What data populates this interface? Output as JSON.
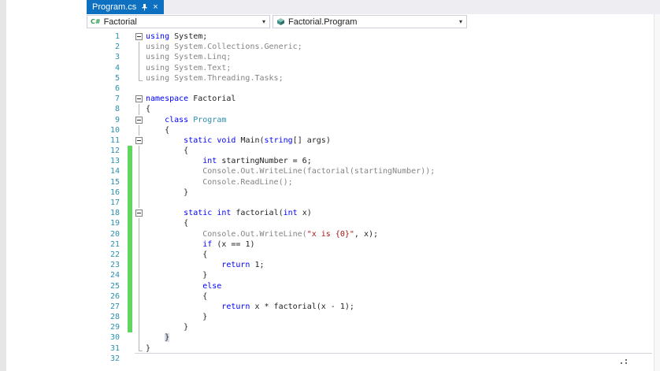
{
  "tab": {
    "title": "Program.cs",
    "close_label": "×"
  },
  "navbar": {
    "dropdown_arrow": "▾",
    "type_selector": {
      "value": "Factorial",
      "icon_label": "C#"
    },
    "member_selector": {
      "value": "Factorial.Program"
    }
  },
  "colors": {
    "tab_active": "#0e70c0",
    "keyword": "#0000ff",
    "type": "#2b91af",
    "string": "#a31515",
    "dimmed": "#848484",
    "default_text": "#1f1f1f",
    "line_number": "#2b91af",
    "change_bar": "#5fd75f"
  },
  "editor": {
    "lines": [
      {
        "n": 1,
        "fold": "minus",
        "chg": false,
        "tokens": [
          {
            "t": "using",
            "c": "k"
          },
          {
            "t": " System;",
            "c": "d"
          }
        ]
      },
      {
        "n": 2,
        "fold": "line",
        "chg": false,
        "tokens": [
          {
            "t": "using System.Collections.Generic;",
            "c": "g"
          }
        ]
      },
      {
        "n": 3,
        "fold": "line",
        "chg": false,
        "tokens": [
          {
            "t": "using System.Linq;",
            "c": "g"
          }
        ]
      },
      {
        "n": 4,
        "fold": "line",
        "chg": false,
        "tokens": [
          {
            "t": "using System.Text;",
            "c": "g"
          }
        ]
      },
      {
        "n": 5,
        "fold": "end",
        "chg": false,
        "tokens": [
          {
            "t": "using System.Threading.Tasks;",
            "c": "g"
          }
        ]
      },
      {
        "n": 6,
        "fold": "",
        "chg": false,
        "tokens": []
      },
      {
        "n": 7,
        "fold": "minus",
        "chg": false,
        "tokens": [
          {
            "t": "namespace",
            "c": "k"
          },
          {
            "t": " Factorial",
            "c": "d"
          }
        ]
      },
      {
        "n": 8,
        "fold": "line",
        "chg": false,
        "tokens": [
          {
            "t": "{",
            "c": "d"
          }
        ]
      },
      {
        "n": 9,
        "fold": "minus",
        "chg": false,
        "tokens": [
          {
            "t": "    ",
            "c": "d"
          },
          {
            "t": "class",
            "c": "k"
          },
          {
            "t": " ",
            "c": "d"
          },
          {
            "t": "Program",
            "c": "t"
          }
        ]
      },
      {
        "n": 10,
        "fold": "line",
        "chg": false,
        "tokens": [
          {
            "t": "    {",
            "c": "d"
          }
        ]
      },
      {
        "n": 11,
        "fold": "minus",
        "chg": false,
        "tokens": [
          {
            "t": "        ",
            "c": "d"
          },
          {
            "t": "static",
            "c": "k"
          },
          {
            "t": " ",
            "c": "d"
          },
          {
            "t": "void",
            "c": "k"
          },
          {
            "t": " Main(",
            "c": "d"
          },
          {
            "t": "string",
            "c": "k"
          },
          {
            "t": "[] args)",
            "c": "d"
          }
        ]
      },
      {
        "n": 12,
        "fold": "line",
        "chg": true,
        "tokens": [
          {
            "t": "        {",
            "c": "d"
          }
        ]
      },
      {
        "n": 13,
        "fold": "line",
        "chg": true,
        "tokens": [
          {
            "t": "            ",
            "c": "d"
          },
          {
            "t": "int",
            "c": "k"
          },
          {
            "t": " startingNumber = 6;",
            "c": "d"
          }
        ]
      },
      {
        "n": 14,
        "fold": "line",
        "chg": true,
        "tokens": [
          {
            "t": "            ",
            "c": "d"
          },
          {
            "t": "Console.Out.WriteLine(factorial(startingNumber));",
            "c": "g"
          }
        ]
      },
      {
        "n": 15,
        "fold": "line",
        "chg": true,
        "tokens": [
          {
            "t": "            ",
            "c": "d"
          },
          {
            "t": "Console.ReadLine();",
            "c": "g"
          }
        ]
      },
      {
        "n": 16,
        "fold": "line",
        "chg": true,
        "tokens": [
          {
            "t": "        }",
            "c": "d"
          }
        ]
      },
      {
        "n": 17,
        "fold": "line",
        "chg": true,
        "tokens": []
      },
      {
        "n": 18,
        "fold": "minus",
        "chg": true,
        "tokens": [
          {
            "t": "        ",
            "c": "d"
          },
          {
            "t": "static",
            "c": "k"
          },
          {
            "t": " ",
            "c": "d"
          },
          {
            "t": "int",
            "c": "k"
          },
          {
            "t": " factorial(",
            "c": "d"
          },
          {
            "t": "int",
            "c": "k"
          },
          {
            "t": " x)",
            "c": "d"
          }
        ]
      },
      {
        "n": 19,
        "fold": "line",
        "chg": true,
        "tokens": [
          {
            "t": "        {",
            "c": "d"
          }
        ]
      },
      {
        "n": 20,
        "fold": "line",
        "chg": true,
        "tokens": [
          {
            "t": "            ",
            "c": "d"
          },
          {
            "t": "Console.Out.WriteLine(",
            "c": "g"
          },
          {
            "t": "\"x is {0}\"",
            "c": "s"
          },
          {
            "t": ", x);",
            "c": "d"
          }
        ]
      },
      {
        "n": 21,
        "fold": "line",
        "chg": true,
        "tokens": [
          {
            "t": "            ",
            "c": "d"
          },
          {
            "t": "if",
            "c": "k"
          },
          {
            "t": " (x == 1)",
            "c": "d"
          }
        ]
      },
      {
        "n": 22,
        "fold": "line",
        "chg": true,
        "tokens": [
          {
            "t": "            {",
            "c": "d"
          }
        ]
      },
      {
        "n": 23,
        "fold": "line",
        "chg": true,
        "tokens": [
          {
            "t": "                ",
            "c": "d"
          },
          {
            "t": "return",
            "c": "k"
          },
          {
            "t": " 1;",
            "c": "d"
          }
        ]
      },
      {
        "n": 24,
        "fold": "line",
        "chg": true,
        "tokens": [
          {
            "t": "            }",
            "c": "d"
          }
        ]
      },
      {
        "n": 25,
        "fold": "line",
        "chg": true,
        "tokens": [
          {
            "t": "            ",
            "c": "d"
          },
          {
            "t": "else",
            "c": "k"
          }
        ]
      },
      {
        "n": 26,
        "fold": "line",
        "chg": true,
        "tokens": [
          {
            "t": "            {",
            "c": "d"
          }
        ]
      },
      {
        "n": 27,
        "fold": "line",
        "chg": true,
        "tokens": [
          {
            "t": "                ",
            "c": "d"
          },
          {
            "t": "return",
            "c": "k"
          },
          {
            "t": " x * factorial(x - 1);",
            "c": "d"
          }
        ]
      },
      {
        "n": 28,
        "fold": "line",
        "chg": true,
        "tokens": [
          {
            "t": "            }",
            "c": "d"
          }
        ]
      },
      {
        "n": 29,
        "fold": "line",
        "chg": true,
        "tokens": [
          {
            "t": "        }",
            "c": "d"
          }
        ]
      },
      {
        "n": 30,
        "fold": "line",
        "chg": false,
        "tokens": [
          {
            "t": "    ",
            "c": "d"
          },
          {
            "t": "}",
            "c": "d",
            "hl": true
          }
        ]
      },
      {
        "n": 31,
        "fold": "end",
        "chg": false,
        "ul": true,
        "tokens": [
          {
            "t": "}",
            "c": "d"
          }
        ]
      },
      {
        "n": 32,
        "fold": "",
        "chg": false,
        "tokens": []
      }
    ]
  }
}
